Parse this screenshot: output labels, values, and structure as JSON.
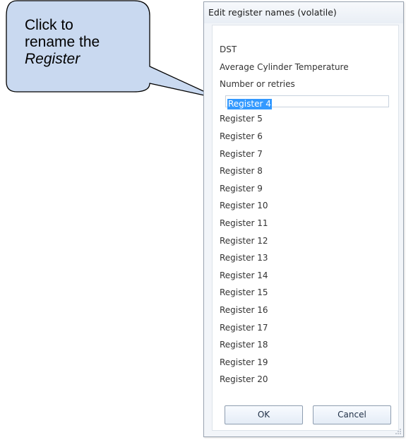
{
  "callout": {
    "line1": "Click to",
    "line2": "rename the",
    "line3": "Register"
  },
  "dialog": {
    "title": "Edit register names (volatile)",
    "editing_value": "Register 4",
    "registers": [
      "DST",
      "Average Cylinder Temperature",
      "Number or retries",
      "",
      "Register 5",
      "Register 6",
      "Register 7",
      "Register 8",
      "Register 9",
      "Register 10",
      "Register 11",
      "Register 12",
      "Register 13",
      "Register 14",
      "Register 15",
      "Register 16",
      "Register 17",
      "Register 18",
      "Register 19",
      "Register 20"
    ],
    "ok_label": "OK",
    "cancel_label": "Cancel"
  },
  "colors": {
    "callout_fill": "#c9d9f0",
    "selection": "#3399ff",
    "dialog_bg": "#f2f5f9"
  }
}
